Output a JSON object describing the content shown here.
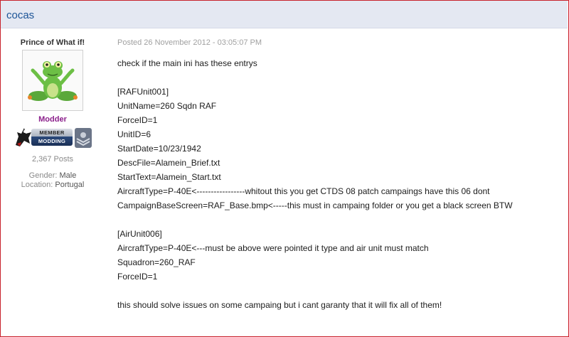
{
  "header": {
    "author_name": "cocas"
  },
  "author": {
    "title": "Prince of What if!",
    "group": "Modder",
    "badge": {
      "top": "MEMBER",
      "bottom": "MODDING"
    },
    "posts": "2,367 Posts",
    "gender_label": "Gender:",
    "gender_value": "Male",
    "location_label": "Location:",
    "location_value": "Portugal"
  },
  "post": {
    "date": "Posted 26 November 2012 - 03:05:07 PM",
    "lines": [
      "check if the main ini has these entrys",
      "",
      "[RAFUnit001]",
      "UnitName=260 Sqdn RAF",
      "ForceID=1",
      "UnitID=6",
      "StartDate=10/23/1942",
      "DescFile=Alamein_Brief.txt",
      "StartText=Alamein_Start.txt",
      "AircraftType=P-40E<-----------------whitout this you get CTDS 08 patch campaings have this 06 dont",
      "CampaignBaseScreen=RAF_Base.bmp<-----this must in campaing folder or you get a black screen BTW",
      "",
      "[AirUnit006]",
      "AircraftType=P-40E<---must be above were pointed it type and air unit must match",
      "Squadron=260_RAF",
      "ForceID=1",
      "",
      "this should solve issues on some campaing but i cant garanty that it will fix all of them!"
    ]
  },
  "colors": {
    "header_bg": "#e4e8f2",
    "author_link": "#1c5497",
    "group_color": "#8b1f8b",
    "frame_border": "#c8222c"
  },
  "icons": {
    "avatar": "frog-avatar-icon",
    "eagle": "eagle-icon",
    "rank": "rank-insignia-icon"
  }
}
